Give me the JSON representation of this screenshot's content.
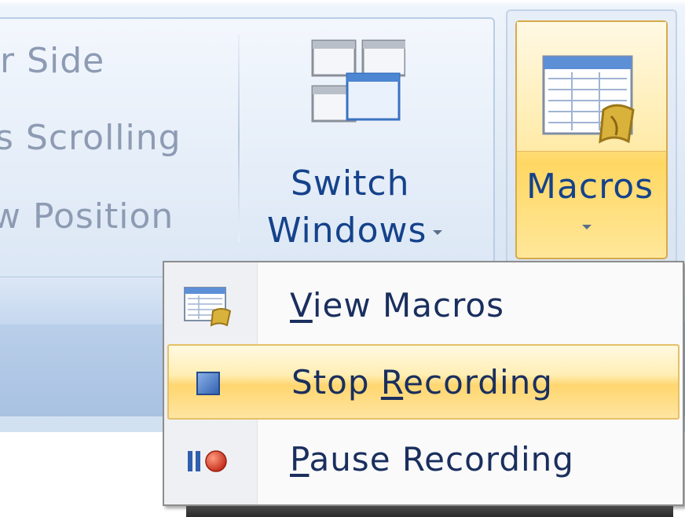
{
  "ribbon": {
    "partial_items": [
      "r Side",
      "s Scrolling",
      "w Position"
    ],
    "switch_windows": {
      "line1": "Switch",
      "line2": "Windows"
    },
    "macros": {
      "label": "Macros"
    }
  },
  "menu": {
    "items": [
      {
        "label": "View Macros",
        "accel_pre": "",
        "accel": "V",
        "accel_post": "iew Macros",
        "icon": "view-macros-icon",
        "highlighted": false
      },
      {
        "label": "Stop Recording",
        "accel_pre": "Stop ",
        "accel": "R",
        "accel_post": "ecording",
        "icon": "stop-recording-icon",
        "highlighted": true
      },
      {
        "label": "Pause Recording",
        "accel_pre": "",
        "accel": "P",
        "accel_post": "ause Recording",
        "icon": "pause-recording-icon",
        "highlighted": false
      }
    ]
  },
  "colors": {
    "highlight": "#ffd66f",
    "text": "#1a2f5e",
    "ribbon_text_dim": "#8d9bb3",
    "button_text": "#15428b",
    "record_red": "#d9412b"
  }
}
